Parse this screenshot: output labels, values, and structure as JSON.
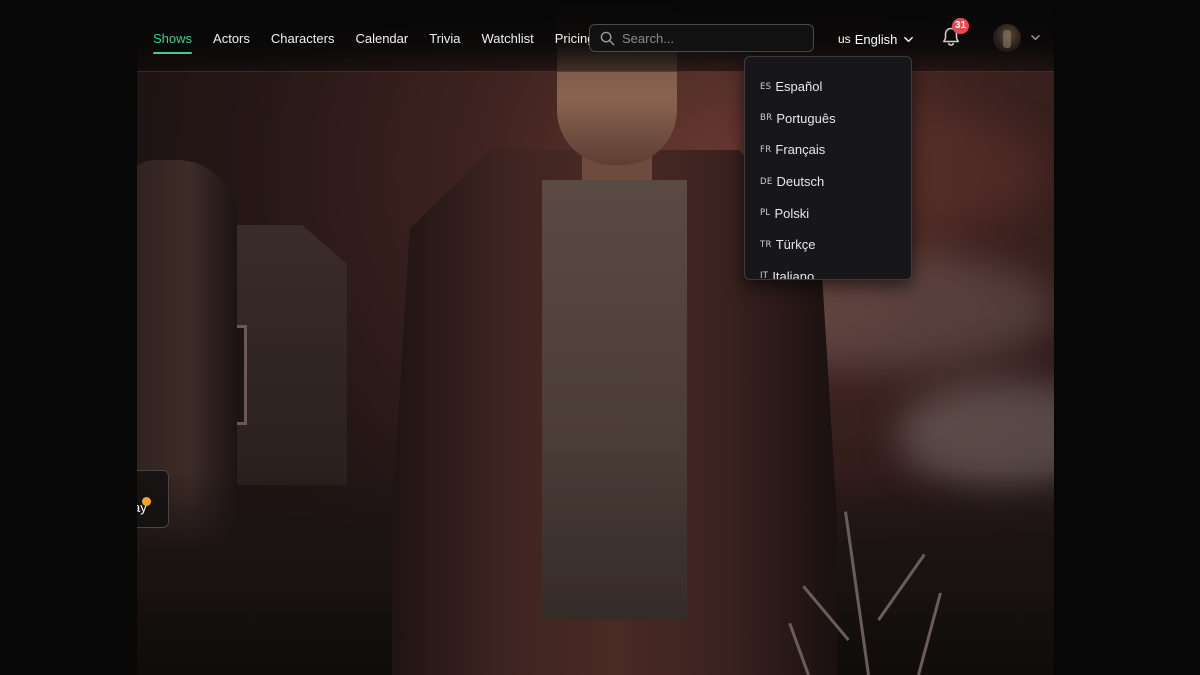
{
  "nav": {
    "items": [
      {
        "label": "Shows",
        "active": true
      },
      {
        "label": "Actors",
        "active": false
      },
      {
        "label": "Characters",
        "active": false
      },
      {
        "label": "Calendar",
        "active": false
      },
      {
        "label": "Trivia",
        "active": false
      },
      {
        "label": "Watchlist",
        "active": false
      },
      {
        "label": "Pricing",
        "active": false
      }
    ],
    "active_color": "#3ecf8e"
  },
  "search": {
    "placeholder": "Search...",
    "value": ""
  },
  "language": {
    "current_code": "us",
    "current_label": "English",
    "options": [
      {
        "code": "ES",
        "label": "Español"
      },
      {
        "code": "BR",
        "label": "Português"
      },
      {
        "code": "FR",
        "label": "Français"
      },
      {
        "code": "DE",
        "label": "Deutsch"
      },
      {
        "code": "PL",
        "label": "Polski"
      },
      {
        "code": "TR",
        "label": "Türkçe"
      },
      {
        "code": "IT",
        "label": "Italiano"
      }
    ]
  },
  "notifications": {
    "count": "31",
    "badge_color": "#e5484d",
    "icon": "bell-icon"
  },
  "user": {
    "icon": "chevron-down-icon"
  },
  "side_card": {
    "text": "ay",
    "dot_color": "#f0a42a"
  }
}
